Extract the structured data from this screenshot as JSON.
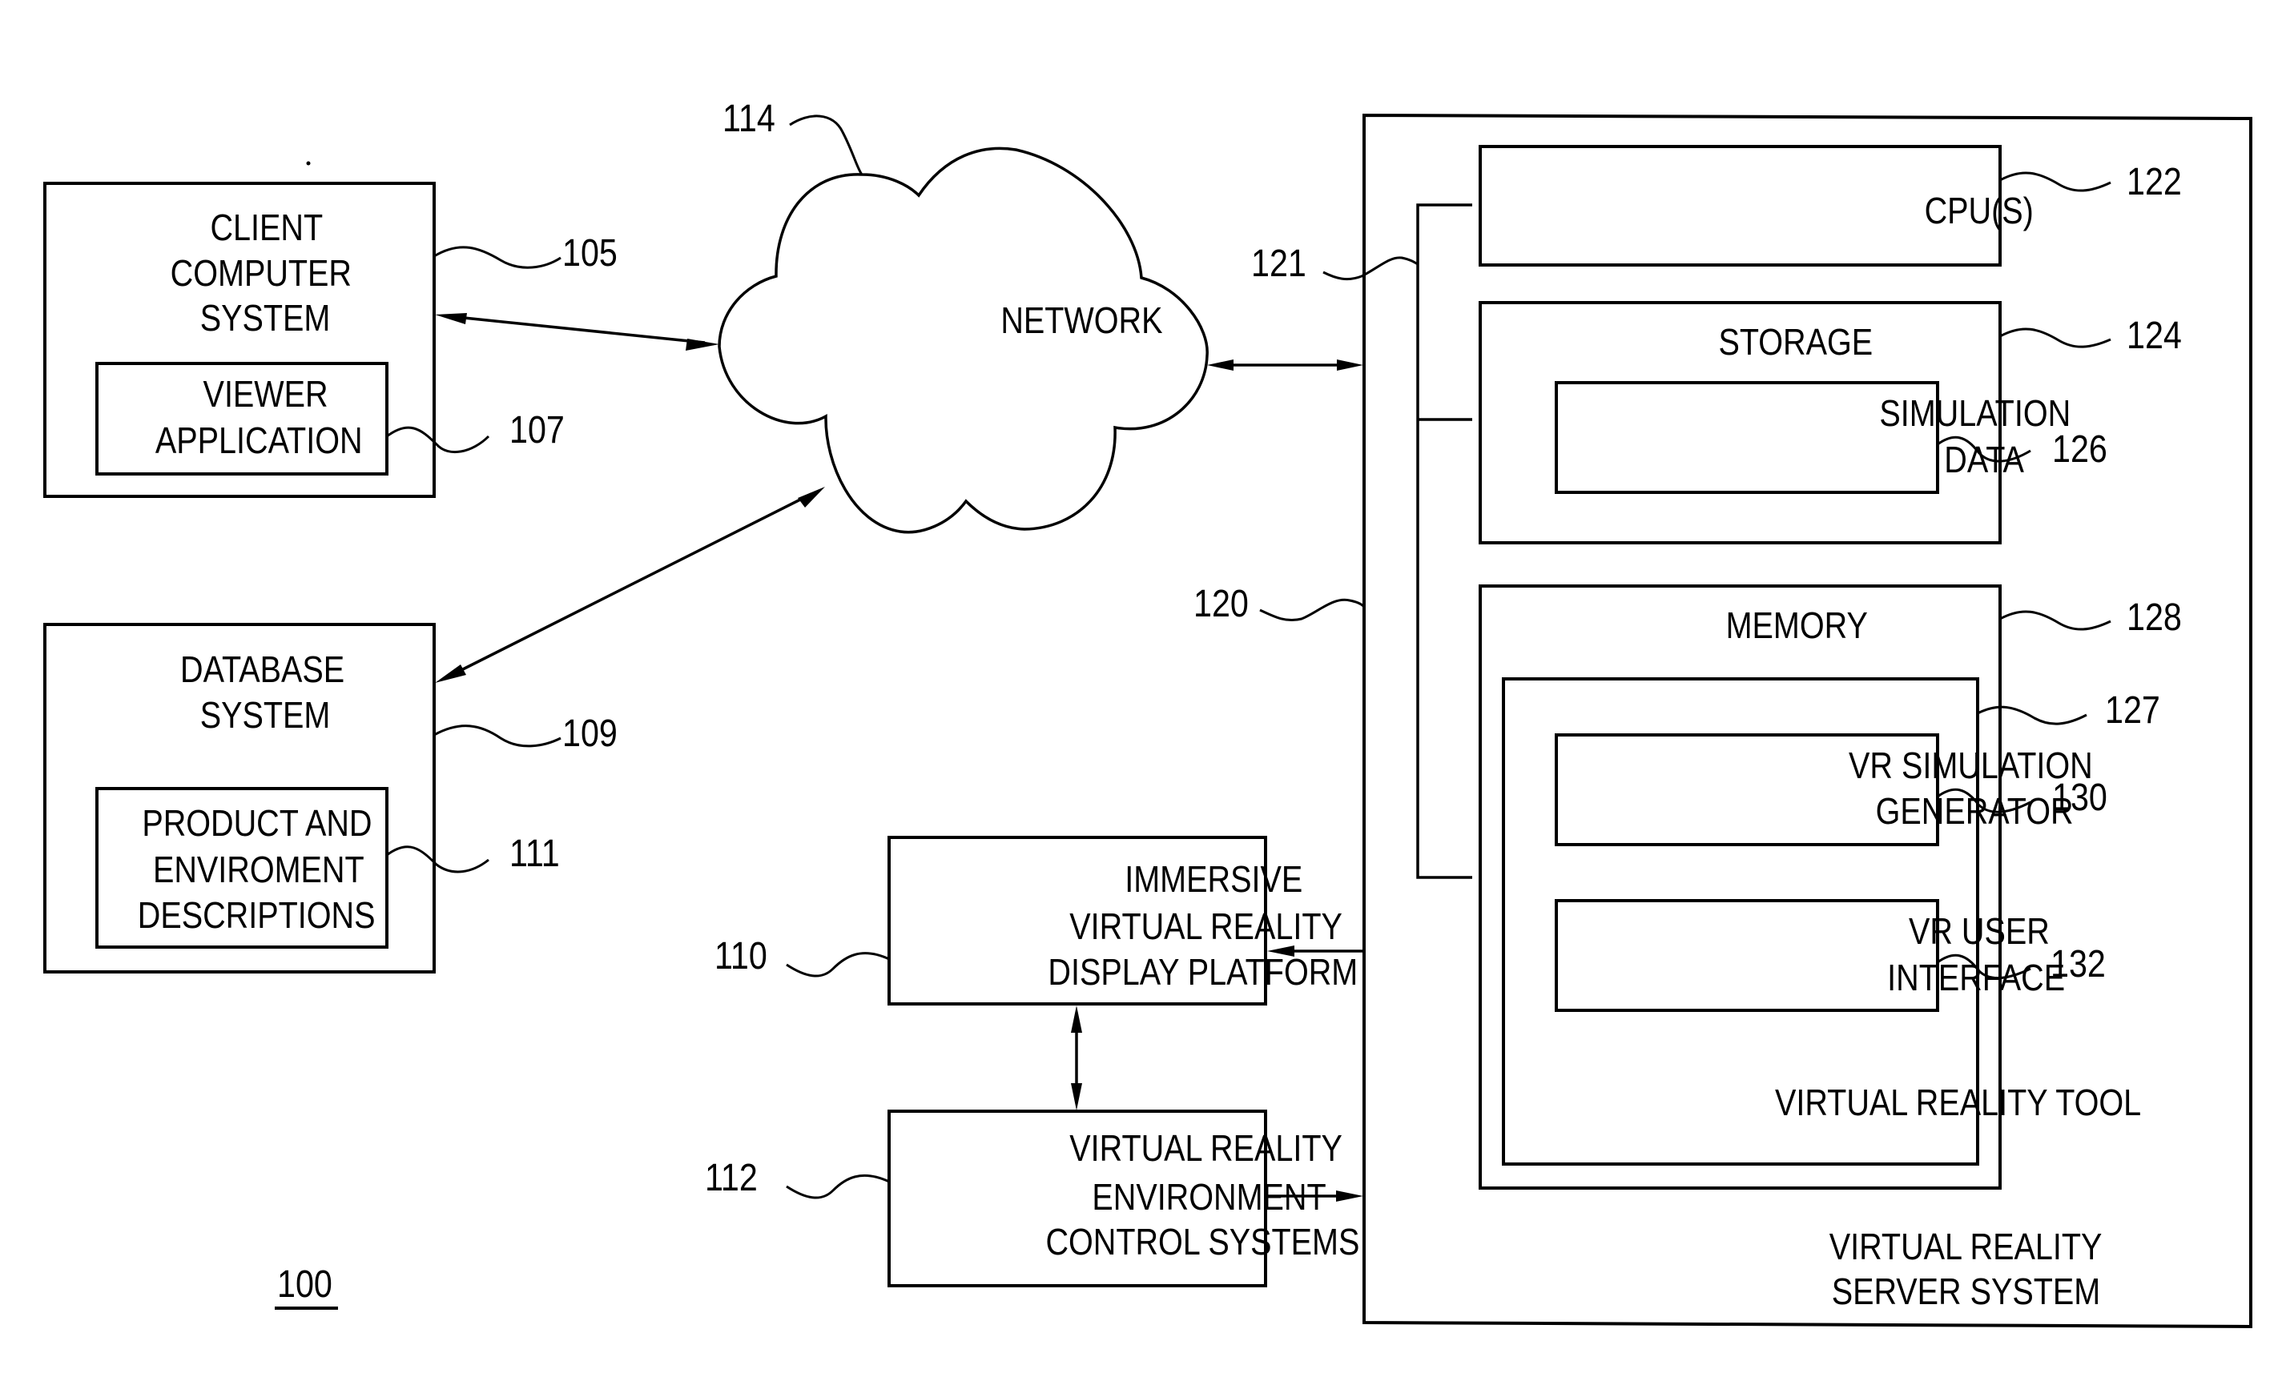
{
  "figure": {
    "number": "100",
    "colors": {
      "ink": "#000000",
      "paper": "#ffffff"
    }
  },
  "client": {
    "ref": "105",
    "title_lines": [
      "CLIENT",
      "COMPUTER",
      "SYSTEM"
    ],
    "viewer": {
      "ref": "107",
      "lines": [
        "VIEWER",
        "APPLICATION"
      ]
    }
  },
  "database": {
    "ref": "109",
    "title_lines": [
      "DATABASE",
      "SYSTEM"
    ],
    "descriptions": {
      "ref": "111",
      "lines": [
        "PRODUCT AND",
        "ENVIROMENT",
        "DESCRIPTIONS"
      ]
    }
  },
  "network": {
    "ref": "114",
    "label": "NETWORK",
    "icon": "cloud-icon"
  },
  "display_platform": {
    "ref": "110",
    "lines": [
      "IMMERSIVE",
      "VIRTUAL REALITY",
      "DISPLAY PLATFORM"
    ]
  },
  "control_systems": {
    "ref": "112",
    "lines": [
      "VIRTUAL REALITY",
      "ENVIRONMENT",
      "CONTROL SYSTEMS"
    ]
  },
  "server": {
    "ref": "120",
    "bus_ref": "121",
    "title_lines": [
      "VIRTUAL REALITY",
      "SERVER SYSTEM"
    ],
    "cpu": {
      "ref": "122",
      "label": "CPU(S)"
    },
    "storage": {
      "ref": "124",
      "label": "STORAGE",
      "simulation_data": {
        "ref": "126",
        "lines": [
          "SIMULATION",
          "DATA"
        ]
      }
    },
    "memory": {
      "ref": "128",
      "label": "MEMORY",
      "vr_tool": {
        "ref": "127",
        "label": "VIRTUAL REALITY TOOL",
        "generator": {
          "ref": "130",
          "lines": [
            "VR SIMULATION",
            "GENERATOR"
          ]
        },
        "user_interface": {
          "ref": "132",
          "lines": [
            "VR USER",
            "INTERFACE"
          ]
        }
      }
    }
  }
}
